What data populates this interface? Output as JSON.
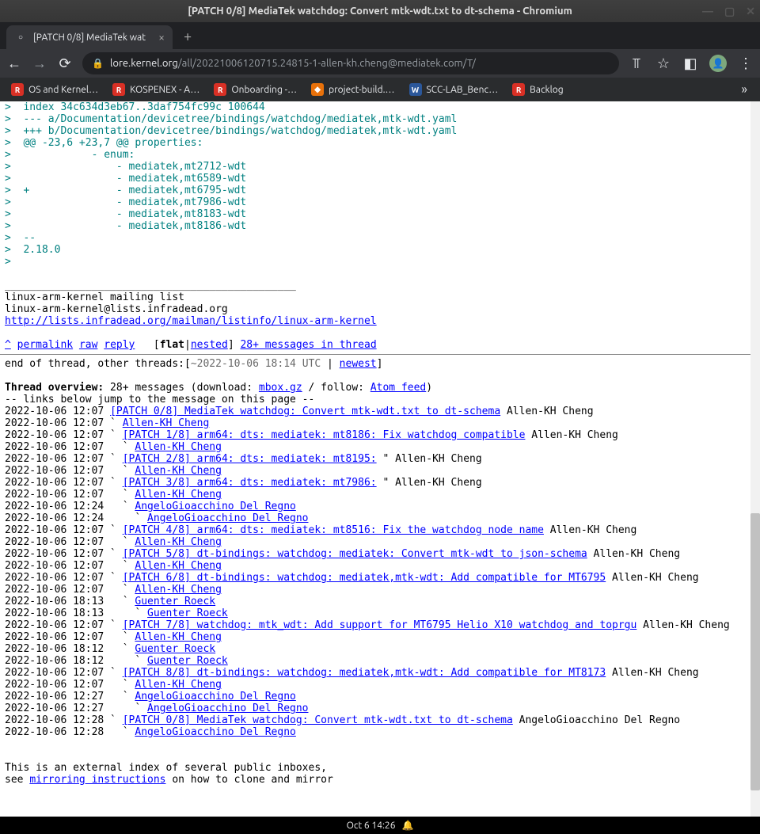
{
  "window": {
    "title": "[PATCH 0/8] MediaTek watchdog: Convert mtk-wdt.txt to dt-schema - Chromium"
  },
  "tab": {
    "title": "[PATCH 0/8] MediaTek wat"
  },
  "address": {
    "domain": "lore.kernel.org",
    "path": "/all/20221006120715.24815-1-allen-kh.cheng@mediatek.com/T/"
  },
  "bookmarks": [
    {
      "icon": "red",
      "label": "OS and Kernel…"
    },
    {
      "icon": "red",
      "label": "KOSPENEX - A…"
    },
    {
      "icon": "red",
      "label": "Onboarding -…"
    },
    {
      "icon": "orange",
      "label": "project-build.…"
    },
    {
      "icon": "blue",
      "label": "SCC-LAB_Benc…"
    },
    {
      "icon": "red",
      "label": "Backlog"
    }
  ],
  "diff": {
    "index": ">  index 34c634d3eb67..3daf754fc99c 100644",
    "from": ">  --- a/Documentation/devicetree/bindings/watchdog/mediatek,mtk-wdt.yaml",
    "to": ">  +++ b/Documentation/devicetree/bindings/watchdog/mediatek,mtk-wdt.yaml",
    "hunk": ">  @@ -23,6 +23,7 @@ properties:",
    "l1": ">             - enum:",
    "l2": ">                 - mediatek,mt2712-wdt",
    "l3": ">                 - mediatek,mt6589-wdt",
    "l4": ">  +              - mediatek,mt6795-wdt",
    "l5": ">                 - mediatek,mt7986-wdt",
    "l6": ">                 - mediatek,mt8183-wdt",
    "l7": ">                 - mediatek,mt8186-wdt",
    "dashes": ">  -- ",
    "ver": ">  2.18.0",
    "blank": "> "
  },
  "footer": {
    "sep": "_______________________________________________",
    "ml1": "linux-arm-kernel mailing list",
    "ml2": "linux-arm-kernel@lists.infradead.org",
    "ml_link": "http://lists.infradead.org/mailman/listinfo/linux-arm-kernel"
  },
  "nav": {
    "caret": "^",
    "permalink": "permalink",
    "raw": "raw",
    "reply": "reply",
    "lb": "[",
    "flat": "flat",
    "pipe": "|",
    "nested": "nested",
    "rb": "]",
    "rest": "28+ messages in thread"
  },
  "eot": {
    "pre": "end of thread, other threads:[",
    "ts": "~2022-10-06 18:14 UTC",
    "mid": " | ",
    "newest": "newest",
    "post": "]"
  },
  "overview": {
    "label": "Thread overview:",
    "pre": " 28+ messages (download: ",
    "mbox": "mbox.gz",
    "mid": " / follow: ",
    "atom": "Atom feed",
    "post": ")",
    "hint": "-- links below jump to the message on this page --"
  },
  "thread": [
    {
      "ts": "2022-10-06 12:07 ",
      "link": "[PATCH 0/8] MediaTek watchdog: Convert mtk-wdt.txt to dt-schema",
      "tail": " Allen-KH Cheng"
    },
    {
      "ts": "2022-10-06 12:07 ` ",
      "link": "Allen-KH Cheng",
      "tail": ""
    },
    {
      "ts": "2022-10-06 12:07 ` ",
      "link": "[PATCH 1/8] arm64: dts: mediatek: mt8186: Fix watchdog compatible",
      "tail": " Allen-KH Cheng"
    },
    {
      "ts": "2022-10-06 12:07   ` ",
      "link": "Allen-KH Cheng",
      "tail": ""
    },
    {
      "ts": "2022-10-06 12:07 ` ",
      "link": "[PATCH 2/8] arm64: dts: mediatek: mt8195:",
      "tail": " \" Allen-KH Cheng"
    },
    {
      "ts": "2022-10-06 12:07   ` ",
      "link": "Allen-KH Cheng",
      "tail": ""
    },
    {
      "ts": "2022-10-06 12:07 ` ",
      "link": "[PATCH 3/8] arm64: dts: mediatek: mt7986:",
      "tail": " \" Allen-KH Cheng"
    },
    {
      "ts": "2022-10-06 12:07   ` ",
      "link": "Allen-KH Cheng",
      "tail": ""
    },
    {
      "ts": "2022-10-06 12:24   ` ",
      "link": "AngeloGioacchino Del Regno",
      "tail": ""
    },
    {
      "ts": "2022-10-06 12:24     ` ",
      "link": "AngeloGioacchino Del Regno",
      "tail": ""
    },
    {
      "ts": "2022-10-06 12:07 ` ",
      "link": "[PATCH 4/8] arm64: dts: mediatek: mt8516: Fix the watchdog node name",
      "tail": " Allen-KH Cheng"
    },
    {
      "ts": "2022-10-06 12:07   ` ",
      "link": "Allen-KH Cheng",
      "tail": ""
    },
    {
      "ts": "2022-10-06 12:07 ` ",
      "link": "[PATCH 5/8] dt-bindings: watchdog: mediatek: Convert mtk-wdt to json-schema",
      "tail": " Allen-KH Cheng"
    },
    {
      "ts": "2022-10-06 12:07   ` ",
      "link": "Allen-KH Cheng",
      "tail": ""
    },
    {
      "ts": "2022-10-06 12:07 ` ",
      "link": "[PATCH 6/8] dt-bindings: watchdog: mediatek,mtk-wdt: Add compatible for MT6795",
      "tail": " Allen-KH Cheng"
    },
    {
      "ts": "2022-10-06 12:07   ` ",
      "link": "Allen-KH Cheng",
      "tail": ""
    },
    {
      "ts": "2022-10-06 18:13   ` ",
      "link": "Guenter Roeck",
      "tail": ""
    },
    {
      "ts": "2022-10-06 18:13     ` ",
      "link": "Guenter Roeck",
      "tail": ""
    },
    {
      "ts": "2022-10-06 12:07 ` ",
      "link": "[PATCH 7/8] watchdog: mtk_wdt: Add support for MT6795 Helio X10 watchdog and toprgu",
      "tail": " Allen-KH Cheng"
    },
    {
      "ts": "2022-10-06 12:07   ` ",
      "link": "Allen-KH Cheng",
      "tail": ""
    },
    {
      "ts": "2022-10-06 18:12   ` ",
      "link": "Guenter Roeck",
      "tail": ""
    },
    {
      "ts": "2022-10-06 18:12     ` ",
      "link": "Guenter Roeck",
      "tail": ""
    },
    {
      "ts": "2022-10-06 12:07 ` ",
      "link": "[PATCH 8/8] dt-bindings: watchdog: mediatek,mtk-wdt: Add compatible for MT8173",
      "tail": " Allen-KH Cheng"
    },
    {
      "ts": "2022-10-06 12:07   ` ",
      "link": "Allen-KH Cheng",
      "tail": ""
    },
    {
      "ts": "2022-10-06 12:27   ` ",
      "link": "AngeloGioacchino Del Regno",
      "tail": ""
    },
    {
      "ts": "2022-10-06 12:27     ` ",
      "link": "AngeloGioacchino Del Regno",
      "tail": ""
    },
    {
      "ts": "2022-10-06 12:28 ` ",
      "link": "[PATCH 0/8] MediaTek watchdog: Convert mtk-wdt.txt to dt-schema",
      "tail": " AngeloGioacchino Del Regno"
    },
    {
      "ts": "2022-10-06 12:28   ` ",
      "link": "AngeloGioacchino Del Regno",
      "tail": ""
    }
  ],
  "ext": {
    "l1": "This is an external index of several public inboxes,",
    "l2a": "see ",
    "l2link": "mirroring instructions",
    "l2b": " on how to clone and mirror"
  },
  "taskbar": {
    "clock": "Oct 6  14:26"
  }
}
